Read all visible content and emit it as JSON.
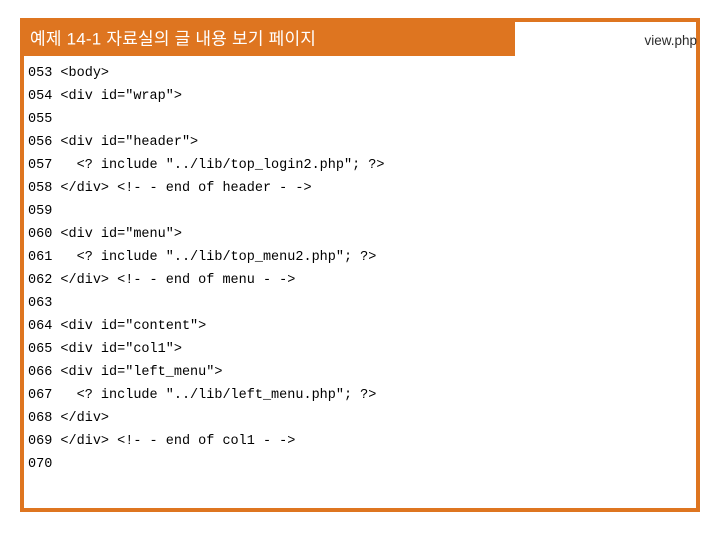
{
  "slide": {
    "title": "예제 14-1 자료실의 글 내용 보기 페이지",
    "file_label": "view.php",
    "accent_color": "#DE7520",
    "title_color": "#FFFFFF",
    "code_color": "#000000",
    "background_color": "#FFFFFF"
  },
  "code": {
    "lines": [
      {
        "number": "053",
        "text": "<body>"
      },
      {
        "number": "054",
        "text": "<div id=\"wrap\">"
      },
      {
        "number": "055",
        "text": ""
      },
      {
        "number": "056",
        "text": "<div id=\"header\">"
      },
      {
        "number": "057",
        "text": "  <? include \"../lib/top_login2.php\"; ?>"
      },
      {
        "number": "058",
        "text": "</div> <!- - end of header - ->"
      },
      {
        "number": "059",
        "text": ""
      },
      {
        "number": "060",
        "text": "<div id=\"menu\">"
      },
      {
        "number": "061",
        "text": "  <? include \"../lib/top_menu2.php\"; ?>"
      },
      {
        "number": "062",
        "text": "</div> <!- - end of menu - ->"
      },
      {
        "number": "063",
        "text": ""
      },
      {
        "number": "064",
        "text": "<div id=\"content\">"
      },
      {
        "number": "065",
        "text": "<div id=\"col1\">"
      },
      {
        "number": "066",
        "text": "<div id=\"left_menu\">"
      },
      {
        "number": "067",
        "text": "  <? include \"../lib/left_menu.php\"; ?>"
      },
      {
        "number": "068",
        "text": "</div>"
      },
      {
        "number": "069",
        "text": "</div> <!- - end of col1 - ->"
      },
      {
        "number": "070",
        "text": ""
      }
    ]
  }
}
